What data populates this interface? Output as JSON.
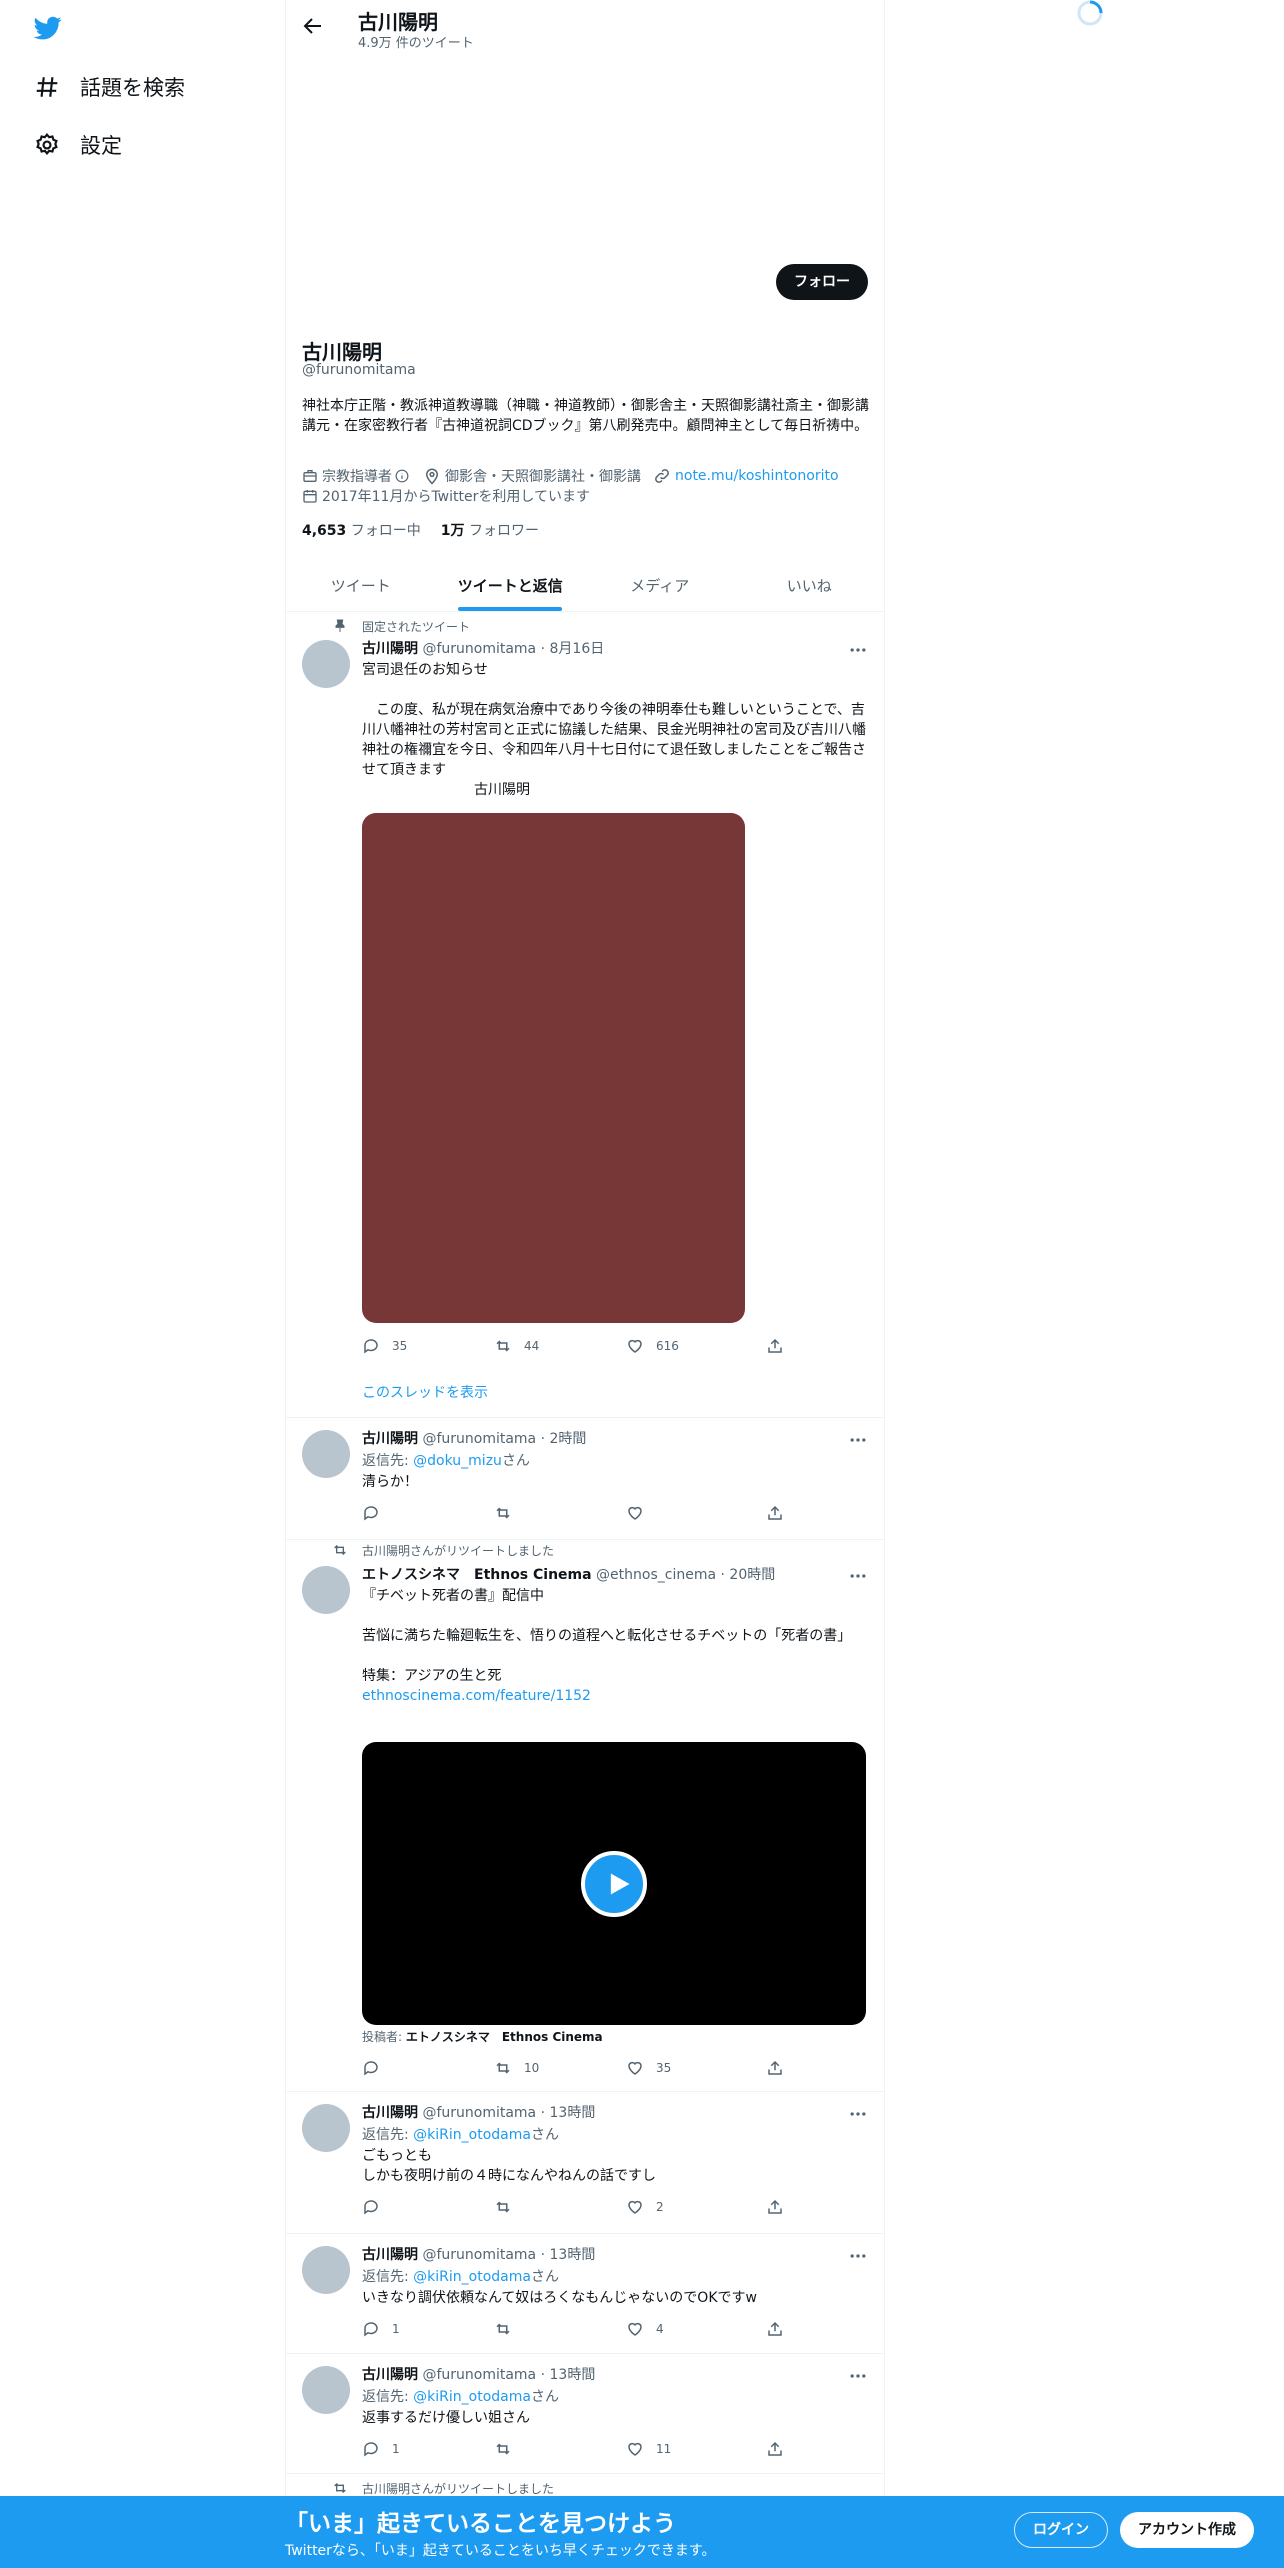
{
  "colors": {
    "accent": "#1d9bf0",
    "text": "#0f1419",
    "muted": "#536471",
    "media": "#773737"
  },
  "nav": {
    "items": [
      {
        "label": "話題を検索",
        "icon": "hashtag-icon"
      },
      {
        "label": "設定",
        "icon": "gear-icon"
      }
    ]
  },
  "header": {
    "title": "古川陽明",
    "tweet_count": "4.9万 件のツイート"
  },
  "profile": {
    "follow_label": "フォロー",
    "name": "古川陽明",
    "handle": "@furunomitama",
    "bio": "神社本庁正階・教派神道教導職（神職・神道教師）・御影舎主・天照御影講社斎主・御影講講元・在家密教行者『古神道祝詞CDブック』第八刷発売中。顧問神主として毎日祈祷中。",
    "category": "宗教指導者",
    "location": "御影舎・天照御影講社・御影講",
    "url": "note.mu/koshintonorito",
    "joined": "2017年11月からTwitterを利用しています",
    "following_count": "4,653",
    "following_label": "フォロー中",
    "followers_count": "1万",
    "followers_label": "フォロワー"
  },
  "tabs": [
    "ツイート",
    "ツイートと返信",
    "メディア",
    "いいね"
  ],
  "tweets": [
    {
      "context": "固定されたツイート",
      "name": "古川陽明",
      "handle": "@furunomitama",
      "time": "8月16日",
      "text": "宮司退任のお知らせ\n\n　この度、私が現在病気治療中であり今後の神明奉仕も難しいということで、吉川八幡神社の芳村宮司と正式に協議した結果、艮金光明神社の宮司及び吉川八幡神社の権禰宜を今日、令和四年八月十七日付にて退任致しましたことをご報告させて頂きます\n　　　　　　　　古川陽明",
      "replies": "35",
      "retweets": "44",
      "likes": "616",
      "thread_link": "このスレッドを表示"
    },
    {
      "name": "古川陽明",
      "handle": "@furunomitama",
      "time": "2時間",
      "reply_prefix": "返信先: ",
      "reply_to": "@doku_mizu",
      "reply_suffix": "さん",
      "text": "清らか！",
      "replies": "",
      "retweets": "",
      "likes": ""
    },
    {
      "context": "古川陽明さんがリツイートしました",
      "name": "エトノスシネマ　Ethnos Cinema",
      "handle": "@ethnos_cinema",
      "time": "20時間",
      "text": "『チベット死者の書』配信中\n\n苦悩に満ちた輪廻転生を、悟りの道程へと転化させるチベットの「死者の書」\n\n特集：アジアの生と死",
      "link": "ethnoscinema.com/feature/1152",
      "byline_prefix": "投稿者: ",
      "byline_name": "エトノスシネマ　Ethnos Cinema",
      "replies": "",
      "retweets": "10",
      "likes": "35"
    },
    {
      "name": "古川陽明",
      "handle": "@furunomitama",
      "time": "13時間",
      "reply_prefix": "返信先: ",
      "reply_to": "@kiRin_otodama",
      "reply_suffix": "さん",
      "text": "ごもっとも\nしかも夜明け前の４時になんやねんの話ですし",
      "replies": "",
      "retweets": "",
      "likes": "2"
    },
    {
      "name": "古川陽明",
      "handle": "@furunomitama",
      "time": "13時間",
      "reply_prefix": "返信先: ",
      "reply_to": "@kiRin_otodama",
      "reply_suffix": "さん",
      "text": "いきなり調伏依頼なんて奴はろくなもんじゃないのでOKですw",
      "replies": "1",
      "retweets": "",
      "likes": "4"
    },
    {
      "name": "古川陽明",
      "handle": "@furunomitama",
      "time": "13時間",
      "reply_prefix": "返信先: ",
      "reply_to": "@kiRin_otodama",
      "reply_suffix": "さん",
      "text": "返事するだけ優しい姐さん",
      "replies": "1",
      "retweets": "",
      "likes": "11"
    },
    {
      "context": "古川陽明さんがリツイートしました"
    }
  ],
  "banner": {
    "title": "「いま」起きていることを見つけよう",
    "subtitle": "Twitterなら、「いま」起きていることをいち早くチェックできます。",
    "login": "ログイン",
    "signup": "アカウント作成"
  }
}
